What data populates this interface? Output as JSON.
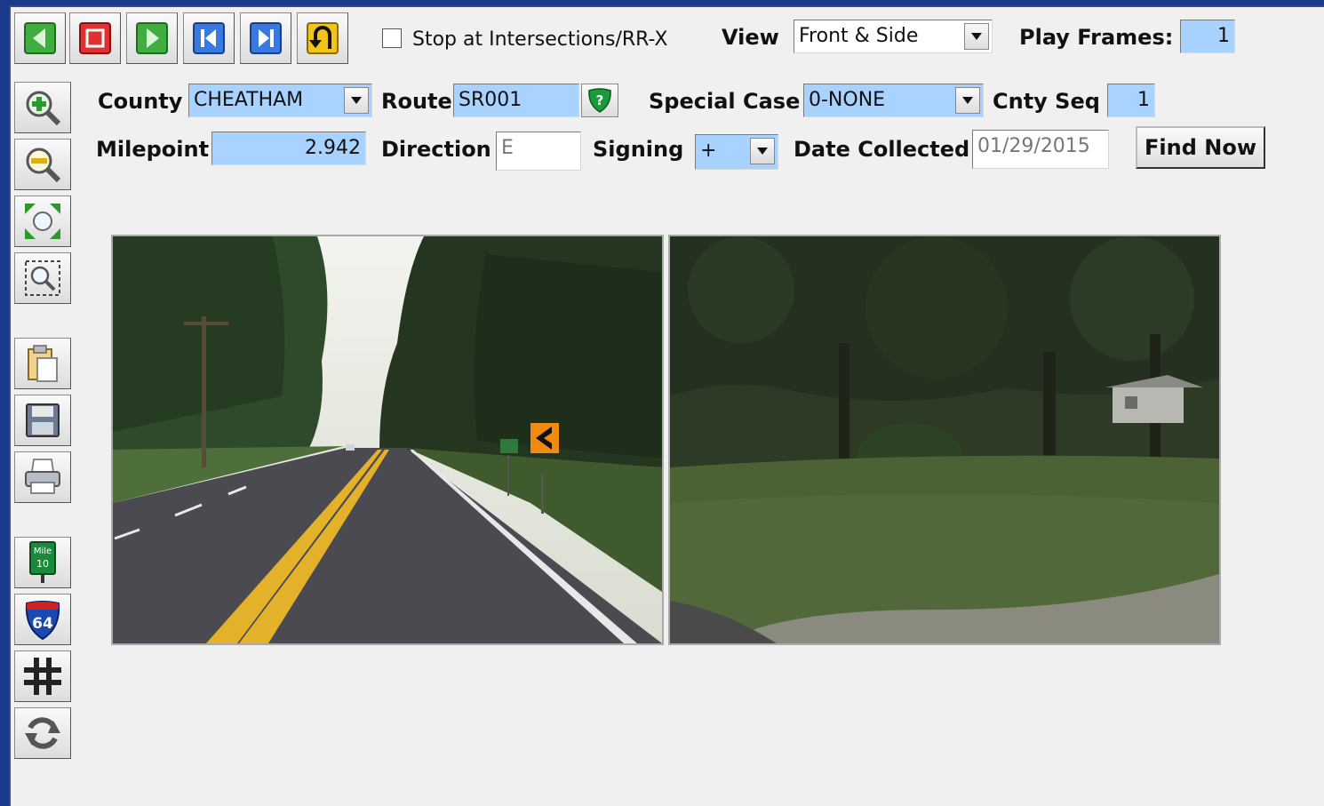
{
  "toolbar": {
    "buttons": [
      {
        "name": "prev-frame-button",
        "icon": "green-left-arrow-icon"
      },
      {
        "name": "stop-button",
        "icon": "red-stop-icon"
      },
      {
        "name": "play-button",
        "icon": "green-play-icon"
      },
      {
        "name": "first-frame-button",
        "icon": "skip-to-start-icon"
      },
      {
        "name": "last-frame-button",
        "icon": "skip-to-end-icon"
      },
      {
        "name": "reverse-direction-button",
        "icon": "u-turn-icon"
      }
    ],
    "stop_at_intersections_label": "Stop at Intersections/RR-X",
    "stop_at_intersections_checked": false,
    "view_label": "View",
    "view_value": "Front & Side",
    "play_frames_label": "Play Frames:",
    "play_frames_value": "1"
  },
  "form": {
    "county_label": "County",
    "county_value": "CHEATHAM",
    "route_label": "Route",
    "route_value": "SR001",
    "special_case_label": "Special Case",
    "special_case_value": "0-NONE",
    "cnty_seq_label": "Cnty Seq",
    "cnty_seq_value": "1",
    "milepoint_label": "Milepoint",
    "milepoint_value": "2.942",
    "direction_label": "Direction",
    "direction_value": "E",
    "signing_label": "Signing",
    "signing_value": "+",
    "date_collected_label": "Date Collected",
    "date_collected_value": "01/29/2015",
    "find_now_label": "Find Now"
  },
  "sidebar": {
    "tools": [
      {
        "name": "zoom-in-button",
        "icon": "zoom-in-icon"
      },
      {
        "name": "zoom-out-button",
        "icon": "zoom-out-icon"
      },
      {
        "name": "full-extent-button",
        "icon": "full-extent-icon"
      },
      {
        "name": "zoom-window-button",
        "icon": "zoom-window-icon"
      },
      {
        "name": "copy-button",
        "icon": "clipboard-icon"
      },
      {
        "name": "save-button",
        "icon": "floppy-disk-icon"
      },
      {
        "name": "print-button",
        "icon": "printer-icon"
      },
      {
        "name": "mile-marker-button",
        "icon": "mile-marker-icon"
      },
      {
        "name": "interstate-shield-button",
        "icon": "interstate-shield-icon"
      },
      {
        "name": "intersection-grid-button",
        "icon": "grid-icon"
      },
      {
        "name": "refresh-button",
        "icon": "refresh-icon"
      }
    ],
    "mile_marker_text": "Mile",
    "mile_marker_number": "10",
    "interstate_number": "64"
  },
  "images": {
    "front": {
      "name": "front-view-image"
    },
    "side": {
      "name": "side-view-image"
    }
  },
  "colors": {
    "field_blue": "#a8d2ff",
    "window_frame": "#1d3a8a"
  }
}
